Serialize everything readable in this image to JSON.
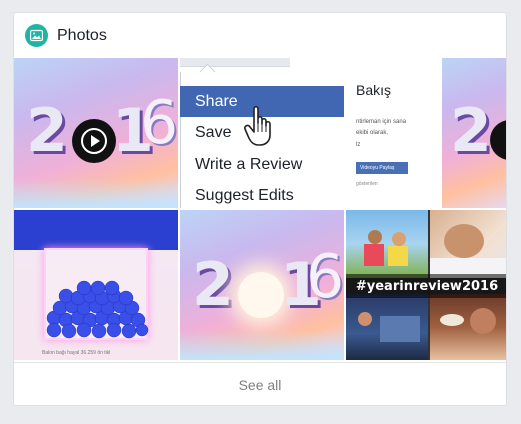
{
  "header": {
    "title": "Photos",
    "icon": "photos-icon",
    "icon_color": "#1fb5a5"
  },
  "menu": {
    "items": [
      {
        "label": "Share"
      },
      {
        "label": "Save"
      },
      {
        "label": "Write a Review"
      },
      {
        "label": "Suggest Edits"
      }
    ],
    "highlight_color": "#4267b2"
  },
  "preview_panel": {
    "heading": "Bakış",
    "snippet_line_1": "ntirleman için sana",
    "snippet_line_2": "ekibi olarak,",
    "snippet_line_3": "lz",
    "button_label": "Videoyu Paylaş",
    "footnote": "gösterilen"
  },
  "tiles": {
    "tile_2016_digits": [
      "2",
      "1",
      "6"
    ],
    "tile_2016_b_digits": [
      "2",
      "1",
      "6"
    ],
    "hashtag": "#yearinreview2016",
    "caption": "Balon bağı hayal 36.259 ön tikl"
  },
  "footer": {
    "see_all": "See all"
  },
  "colors": {
    "accent": "#4267b2",
    "card_bg": "#ffffff",
    "page_bg": "#e9ebee"
  }
}
